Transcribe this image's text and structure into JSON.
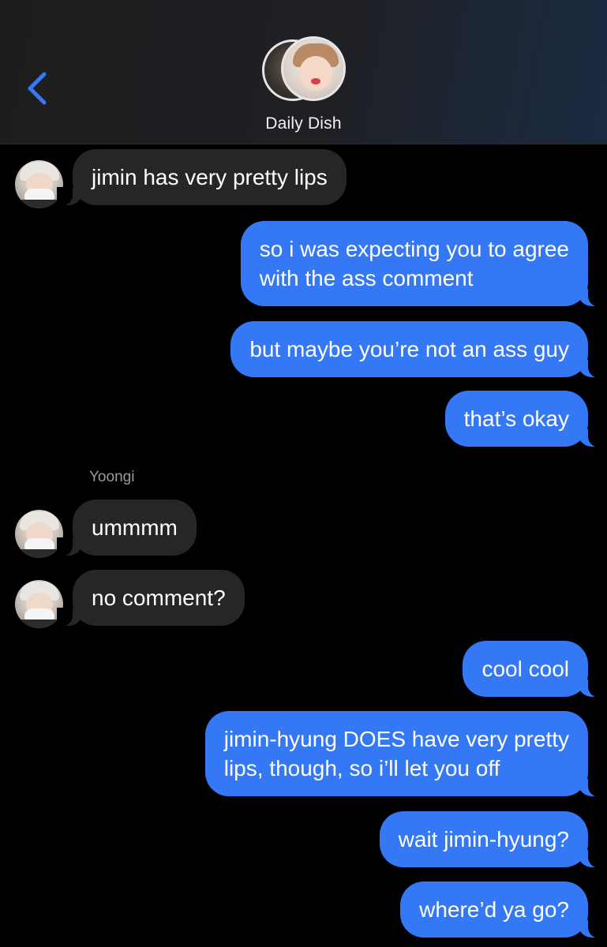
{
  "header": {
    "title": "Daily Dish",
    "back_icon": "chevron-left-icon",
    "accent_color": "#3478f6"
  },
  "messages": {
    "m1": "jimin has very pretty lips",
    "m2_line1": "so i was expecting you to agree",
    "m2_line2": "with the ass comment",
    "m3": "but maybe you’re not an ass guy",
    "m4": "that’s okay",
    "sender": "Yoongi",
    "m5": "ummmm",
    "m6": "no comment?",
    "m7": "cool cool",
    "m8_line1": "jimin-hyung DOES have very pretty",
    "m8_line2": "lips, though, so i’ll let you off",
    "m9": "wait jimin-hyung?",
    "m10": "where’d ya go?"
  },
  "colors": {
    "outgoing_bubble": "#3478f6",
    "incoming_bubble": "#262628",
    "background": "#000000"
  }
}
